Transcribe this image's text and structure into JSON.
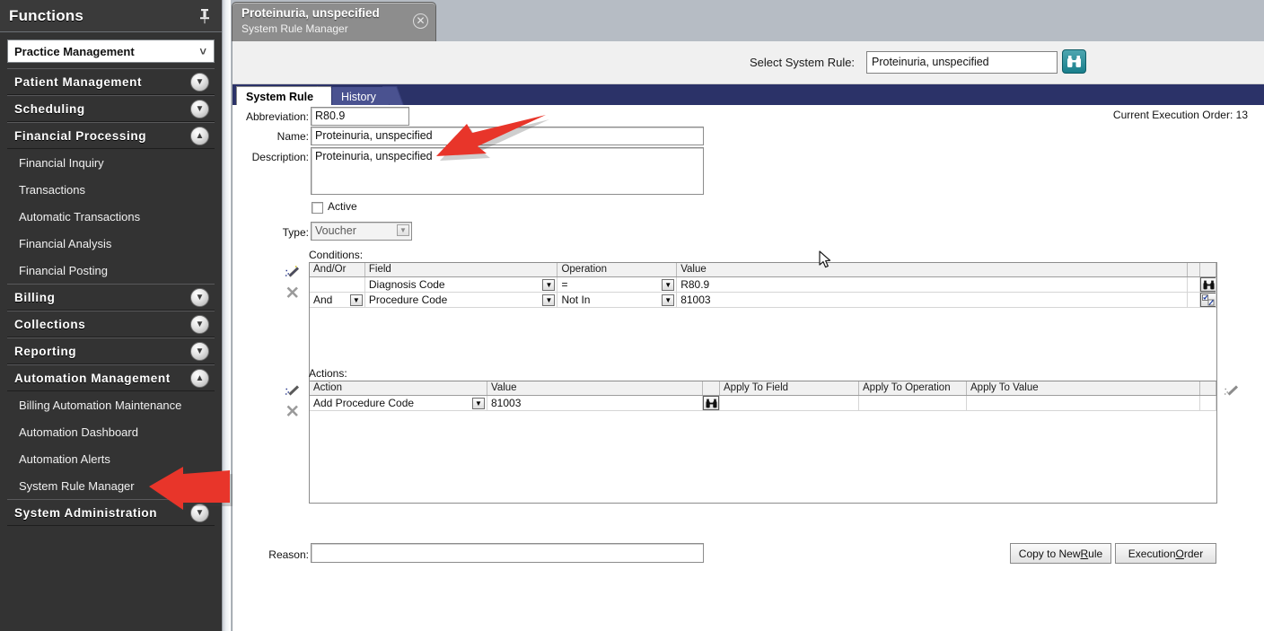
{
  "sidebar": {
    "title": "Functions",
    "pin_icon": "pushpin-icon",
    "module_select": {
      "value": "Practice Management",
      "chevron": "chevron-down-icon"
    },
    "groups": [
      {
        "label": "Patient Management",
        "state": "collapsed",
        "icon": "chevron-down-circle-icon",
        "items": []
      },
      {
        "label": "Scheduling",
        "state": "collapsed",
        "icon": "chevron-down-circle-icon",
        "items": []
      },
      {
        "label": "Financial Processing",
        "state": "expanded",
        "icon": "chevron-up-circle-icon",
        "items": [
          "Financial Inquiry",
          "Transactions",
          "Automatic Transactions",
          "Financial Analysis",
          "Financial Posting"
        ]
      },
      {
        "label": "Billing",
        "state": "collapsed",
        "icon": "chevron-down-circle-icon",
        "items": []
      },
      {
        "label": "Collections",
        "state": "collapsed",
        "icon": "chevron-down-circle-icon",
        "items": []
      },
      {
        "label": "Reporting",
        "state": "collapsed",
        "icon": "chevron-down-circle-icon",
        "items": []
      },
      {
        "label": "Automation Management",
        "state": "expanded",
        "icon": "chevron-up-circle-icon",
        "items": [
          "Billing Automation Maintenance",
          "Automation Dashboard",
          "Automation Alerts",
          "System Rule Manager"
        ]
      },
      {
        "label": "System Administration",
        "state": "collapsed",
        "icon": "chevron-down-circle-icon",
        "items": []
      }
    ]
  },
  "document_tab": {
    "title": "Proteinuria, unspecified",
    "subtitle": "System Rule Manager",
    "close_icon": "close-circle-icon"
  },
  "toolbar": {
    "select_label": "Select System Rule:",
    "select_value": "Proteinuria, unspecified",
    "find_icon": "binoculars-icon"
  },
  "tabs": [
    {
      "label": "System Rule",
      "active": true
    },
    {
      "label": "History",
      "active": false
    }
  ],
  "form": {
    "abbreviation_label": "Abbreviation:",
    "abbreviation_value": "R80.9",
    "name_label": "Name:",
    "name_value": "Proteinuria, unspecified",
    "description_label": "Description:",
    "description_value": "Proteinuria, unspecified",
    "active_label": "Active",
    "active_checked": false,
    "type_label": "Type:",
    "type_value": "Voucher",
    "execution_order": "Current Execution Order: 13"
  },
  "conditions": {
    "label": "Conditions:",
    "add_icon": "magic-wand-icon",
    "delete_icon": "x-delete-icon",
    "columns": [
      "And/Or",
      "Field",
      "Operation",
      "Value",
      "",
      ""
    ],
    "rows": [
      {
        "andor": "",
        "field": "Diagnosis Code",
        "operation": "=",
        "value": "R80.9",
        "lookup_icon": "binoculars-icon"
      },
      {
        "andor": "And",
        "field": "Procedure Code",
        "operation": "Not In",
        "value": "81003",
        "lookup_icon": "edit-checkbox-icon"
      }
    ]
  },
  "actions": {
    "label": "Actions:",
    "add_icon": "magic-wand-icon",
    "delete_icon": "x-delete-icon",
    "right_icon": "magic-wand-icon",
    "columns": [
      "Action",
      "Value",
      "",
      "Apply To Field",
      "Apply To Operation",
      "Apply To Value",
      ""
    ],
    "rows": [
      {
        "action": "Add Procedure Code",
        "value": "81003",
        "lookup_icon": "binoculars-icon",
        "apply_to_field": "",
        "apply_to_operation": "",
        "apply_to_value": ""
      }
    ]
  },
  "footer": {
    "reason_label": "Reason:",
    "reason_value": "",
    "copy_button": {
      "pre": "Copy to New ",
      "accel": "R",
      "post": "ule"
    },
    "exec_button": {
      "pre": "Execution ",
      "accel": "O",
      "post": "rder"
    }
  },
  "cursor": {
    "icon": "mouse-pointer-icon"
  },
  "annotations": [
    {
      "name": "arrow-to-name-field",
      "color": "#e8352a"
    },
    {
      "name": "arrow-to-system-rule-manager",
      "color": "#e8352a"
    }
  ]
}
